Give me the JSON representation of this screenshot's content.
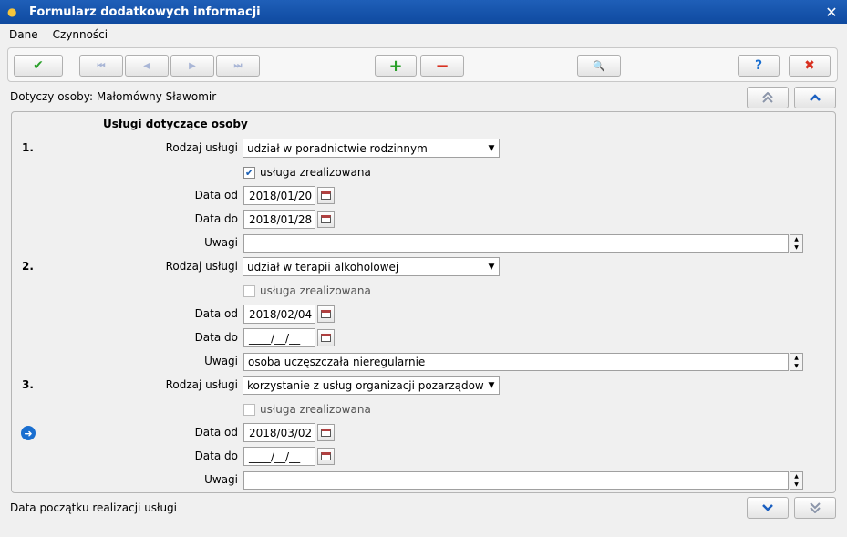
{
  "window": {
    "title": "Formularz dodatkowych informacji",
    "close_glyph": "✕"
  },
  "menu": {
    "items": [
      "Dane",
      "Czynności"
    ]
  },
  "toolbar": {
    "ok": "✔",
    "first": "⏮",
    "prev": "◀",
    "next": "▶",
    "last": "⏭",
    "add": "+",
    "remove": "−",
    "search": "🔍",
    "help": "?",
    "cancel": "✖"
  },
  "person": {
    "line": "Dotyczy osoby: Małomówny Sławomir"
  },
  "section": {
    "title": "Usługi dotyczące osoby"
  },
  "labels": {
    "service_type": "Rodzaj usługi",
    "realized": "usługa zrealizowana",
    "date_from": "Data od",
    "date_to": "Data do",
    "notes": "Uwagi"
  },
  "services": [
    {
      "num": "1.",
      "type": "udział w poradnictwie rodzinnym",
      "realized": true,
      "date_from": "2018/01/20",
      "date_to": "2018/01/28",
      "notes": ""
    },
    {
      "num": "2.",
      "type": "udział w terapii alkoholowej",
      "realized": false,
      "date_from": "2018/02/04",
      "date_to": "____/__/__",
      "notes": "osoba uczęszczała nieregularnie"
    },
    {
      "num": "3.",
      "type": "korzystanie z usług organizacji pozarządowej",
      "realized": false,
      "date_from": "2018/03/02",
      "date_to": "____/__/__",
      "notes": ""
    }
  ],
  "status": {
    "hint": "Data początku realizacji usługi"
  },
  "colors": {
    "titlebar": "#1f5fb8",
    "accent": "#1a6fd0",
    "ok_green": "#2aa02a",
    "cancel_red": "#d83020"
  }
}
